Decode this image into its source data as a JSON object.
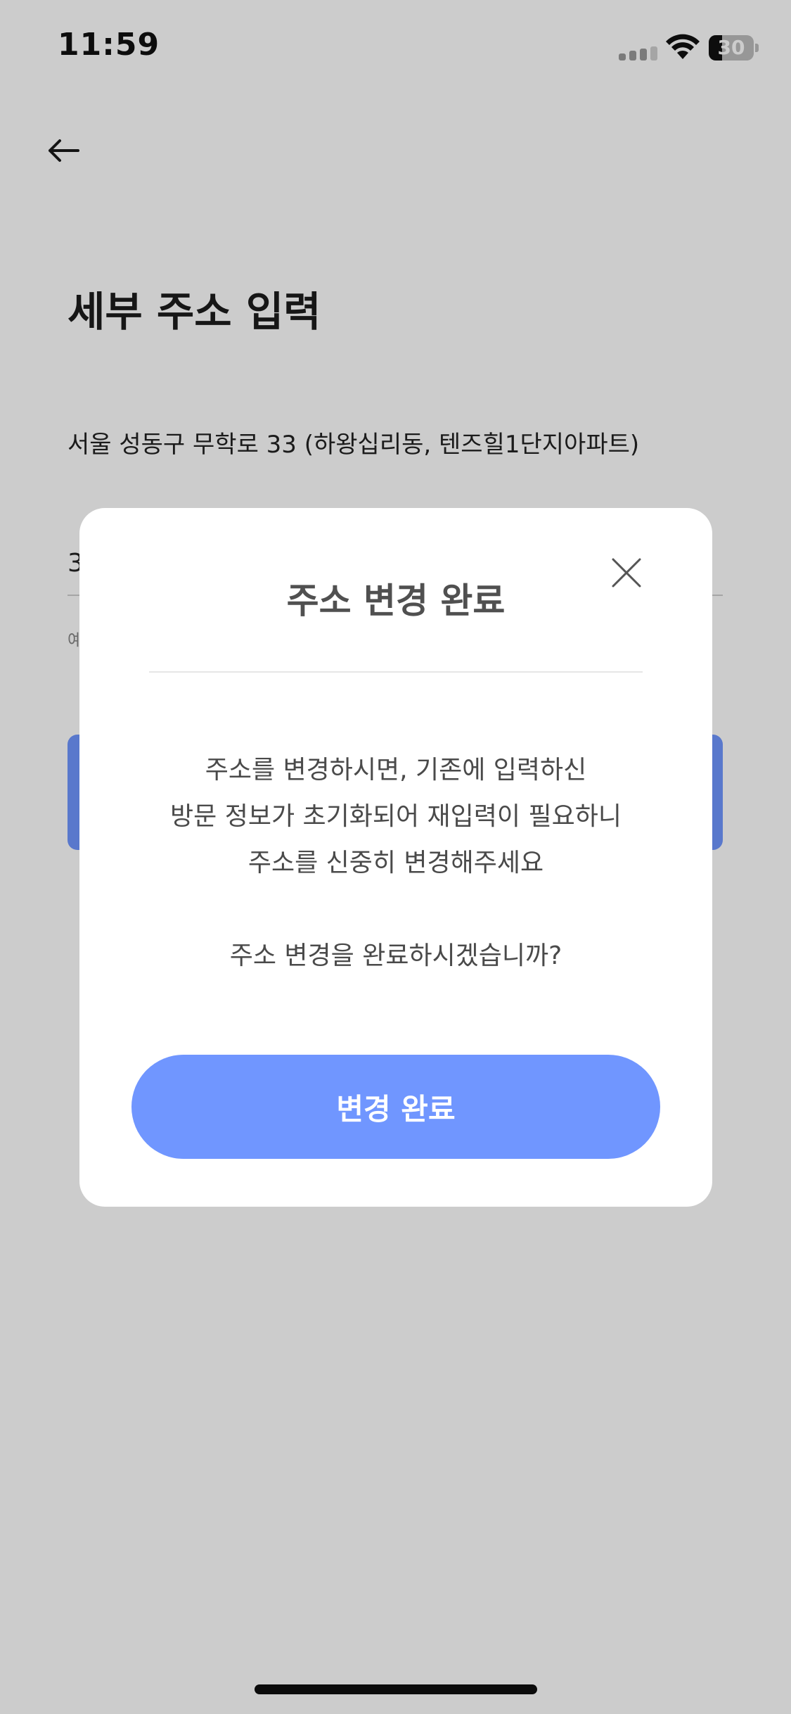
{
  "status_bar": {
    "time": "11:59",
    "battery_level": "30",
    "battery_fraction": 0.3,
    "icons": [
      "signal-icon",
      "wifi-icon",
      "battery-icon"
    ]
  },
  "header": {
    "back_icon": "arrow-left-icon",
    "title": "세부 주소 입력"
  },
  "address": {
    "base_address": "서울 성동구 무학로 33 (하왕십리동, 텐즈힐1단지아파트)",
    "detail_value": "3",
    "helper_text": "예"
  },
  "modal": {
    "title": "주소 변경 완료",
    "close_icon": "close-icon",
    "message_lines": [
      "주소를 변경하시면, 기존에 입력하신",
      "방문 정보가 초기화되어 재입력이 필요하니",
      "주소를 신중히 변경해주세요"
    ],
    "question": "주소 변경을 완료하시겠습니까?",
    "confirm_label": "변경 완료"
  },
  "colors": {
    "accent": "#7096ff",
    "overlay": "rgba(0,0,0,0.2)",
    "title_text": "#505050",
    "body_text": "#4a4a4a"
  }
}
